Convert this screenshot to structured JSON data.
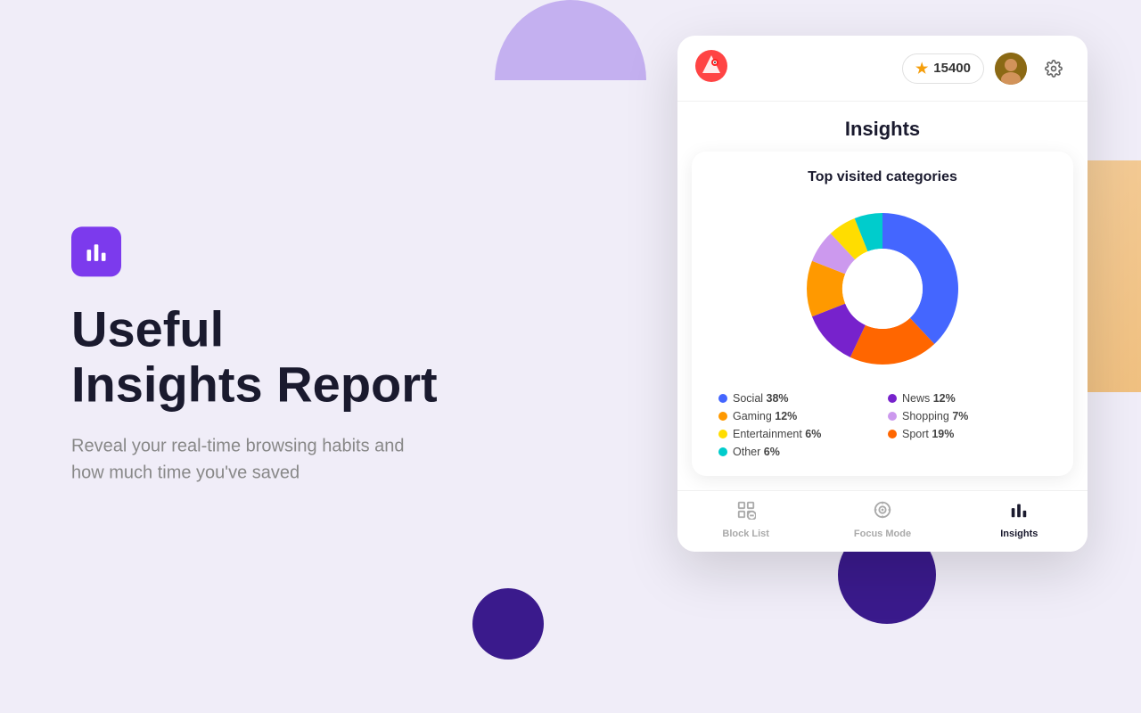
{
  "page": {
    "background_color": "#f0edf8"
  },
  "left": {
    "icon_label": "bar-chart-icon",
    "title_line1": "Useful",
    "title_line2": "Insights Report",
    "subtitle": "Reveal your real-time browsing habits and how much time you've saved"
  },
  "browser": {
    "header": {
      "points": "15400",
      "points_label": "15400"
    },
    "page_title": "Insights",
    "card": {
      "title": "Top visited categories",
      "chart": {
        "segments": [
          {
            "label": "Social",
            "pct": 38,
            "color": "#4466ff",
            "start_angle": 0
          },
          {
            "label": "Sport",
            "pct": 19,
            "color": "#ff6600",
            "start_angle": 136.8
          },
          {
            "label": "News",
            "pct": 12,
            "color": "#6600cc",
            "start_angle": 205.2
          },
          {
            "label": "Gaming",
            "pct": 12,
            "color": "#ff8800",
            "start_angle": 248.4
          },
          {
            "label": "Shopping",
            "pct": 7,
            "color": "#cc99ff",
            "start_angle": 291.6
          },
          {
            "label": "Entertainment",
            "pct": 6,
            "color": "#ffdd00",
            "start_angle": 316.8
          },
          {
            "label": "Other",
            "pct": 6,
            "color": "#00cccc",
            "start_angle": 338.4
          }
        ]
      },
      "legend": [
        {
          "label": "Social",
          "pct": "38%",
          "color": "#4466ff"
        },
        {
          "label": "News",
          "pct": "12%",
          "color": "#6600cc"
        },
        {
          "label": "Gaming",
          "pct": "12%",
          "color": "#ff8800"
        },
        {
          "label": "Shopping",
          "pct": "7%",
          "color": "#cc99ff"
        },
        {
          "label": "Entertainment",
          "pct": "6%",
          "color": "#ffdd00"
        },
        {
          "label": "Sport",
          "pct": "19%",
          "color": "#ff6600"
        },
        {
          "label": "Other",
          "pct": "6%",
          "color": "#00cccc"
        }
      ]
    },
    "nav": {
      "items": [
        {
          "label": "Block List",
          "icon": "block-list-icon",
          "active": false
        },
        {
          "label": "Focus Mode",
          "icon": "focus-mode-icon",
          "active": false
        },
        {
          "label": "Insights",
          "icon": "insights-nav-icon",
          "active": true
        }
      ]
    }
  }
}
